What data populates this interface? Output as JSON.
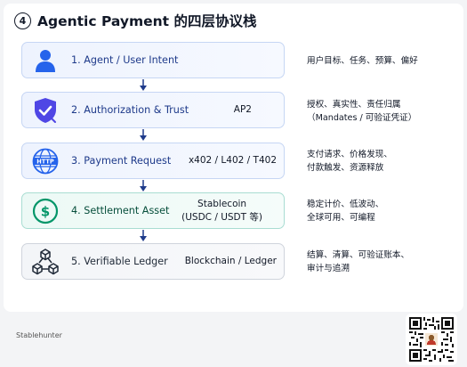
{
  "title": {
    "number": "4",
    "text": "Agentic Payment 的四层协议栈"
  },
  "layers": [
    {
      "name": "1. Agent / User Intent",
      "tag": [],
      "description": [
        "用户目标、任务、预算、偏好"
      ],
      "icon": "user-icon",
      "color": "#2563eb"
    },
    {
      "name": "2. Authorization & Trust",
      "tag": [
        "AP2"
      ],
      "description": [
        "授权、真实性、责任归属",
        "（Mandates / 可验证凭证）"
      ],
      "icon": "shield-check-icon",
      "color": "#4f46e5"
    },
    {
      "name": "3. Payment Request",
      "tag": [
        "x402 / L402 / T402"
      ],
      "description": [
        "支付请求、价格发现、",
        "付款触发、资源释放"
      ],
      "icon": "http-globe-icon",
      "color": "#2563eb"
    },
    {
      "name": "4. Settlement Asset",
      "tag": [
        "Stablecoin",
        "(USDC / USDT 等)"
      ],
      "description": [
        "稳定计价、低波动、",
        "全球可用、可编程"
      ],
      "icon": "dollar-coin-icon",
      "color": "#059669"
    },
    {
      "name": "5. Verifiable Ledger",
      "tag": [
        "Blockchain / Ledger"
      ],
      "description": [
        "结算、清算、可验证账本、",
        "审计与追溯"
      ],
      "icon": "blockchain-cubes-icon",
      "color": "#1f2937"
    }
  ],
  "footer": {
    "brand": "Stablehunter"
  }
}
